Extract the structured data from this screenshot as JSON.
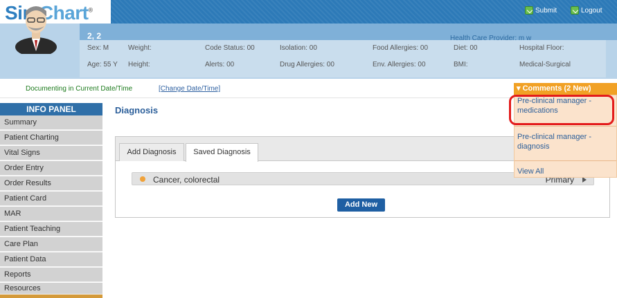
{
  "app": {
    "logo_sim": "Sim",
    "logo_chart": "Chart",
    "logo_reg": "®"
  },
  "topbar": {
    "submit": "Submit",
    "logout": "Logout"
  },
  "patient": {
    "name": "2, 2",
    "provider": "Health Care Provider: m w",
    "sex": "Sex: M",
    "age": "Age: 55 Y",
    "weight": "Weight:",
    "height": "Height:",
    "code_status": "Code Status: 00",
    "alerts": "Alerts: 00",
    "isolation": "Isolation: 00",
    "drug_allergies": "Drug Allergies: 00",
    "food_allergies": "Food Allergies: 00",
    "env_allergies": "Env. Allergies: 00",
    "diet": "Diet: 00",
    "bmi": "BMI:",
    "hospital_floor": "Hospital Floor:",
    "unit": "Medical-Surgical"
  },
  "docbar": {
    "text": "Documenting in Current Date/Time",
    "link": "[Change Date/Time]"
  },
  "sidebar": {
    "title": "INFO PANEL",
    "items": [
      "Summary",
      "Patient Charting",
      "Vital Signs",
      "Order Entry",
      "Order Results",
      "Patient Card",
      "MAR",
      "Patient Teaching",
      "Care Plan",
      "Patient Data",
      "Reports",
      "Resources"
    ]
  },
  "main": {
    "title": "Diagnosis",
    "tabs": [
      "Add Diagnosis",
      "Saved Diagnosis"
    ],
    "diagnosis": {
      "name": "Cancer, colorectal",
      "type": "Primary"
    },
    "add_new": "Add New"
  },
  "comments": {
    "header": "▾ Comments (2 New)",
    "items": [
      "Pre-clinical manager - medications",
      "Pre-clinical manager - diagnosis"
    ],
    "view_all": "View All"
  },
  "colors": {
    "accent": "#2f6fa8",
    "comments": "#f1a125",
    "highlight": "#e31b1b"
  }
}
